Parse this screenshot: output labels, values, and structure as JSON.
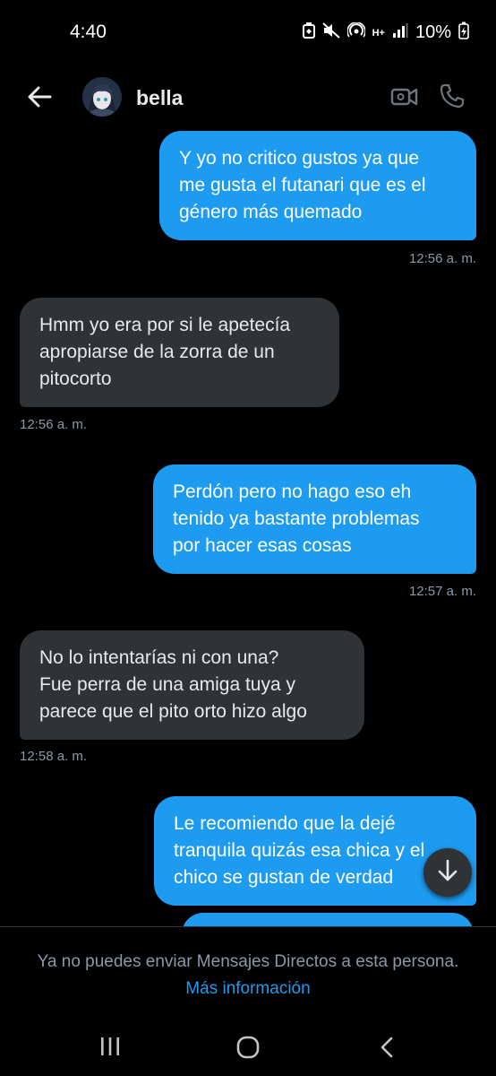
{
  "status_bar": {
    "time": "4:40",
    "battery": "10%",
    "network": "H+"
  },
  "header": {
    "contact_name": "bella",
    "back_icon": "arrow-left-icon",
    "video_icon": "video-camera-icon",
    "call_icon": "phone-icon"
  },
  "messages": [
    {
      "direction": "outgoing",
      "lines": [
        "Y yo no critico gustos ya que",
        "me gusta el futanari que es el",
        "género más quemado"
      ],
      "time": "12:56 a. m."
    },
    {
      "direction": "incoming",
      "lines": [
        "Hmm yo era por si le apetecía",
        "apropiarse de la zorra de un",
        "pitocorto"
      ],
      "time": "12:56 a. m."
    },
    {
      "direction": "outgoing",
      "lines": [
        "Perdón pero no hago eso eh",
        "tenido ya bastante problemas",
        "por hacer esas cosas"
      ],
      "time": "12:57 a. m."
    },
    {
      "direction": "incoming",
      "lines": [
        "No lo intentarías ni con una?",
        "Fue perra de una amiga tuya y",
        "parece que el pito orto hizo algo"
      ],
      "time": "12:58 a. m."
    },
    {
      "direction": "outgoing",
      "lines": [
        "Le recomiendo que la dejé",
        "tranquila quizás esa chica y el",
        "chico se gustan de verdad"
      ],
      "time": ""
    }
  ],
  "footer": {
    "notice": "Ya no puedes enviar Mensajes Directos a esta persona.",
    "link": "Más información"
  },
  "colors": {
    "background": "#000000",
    "outgoing_bubble": "#1d9bf0",
    "incoming_bubble": "#2f3336",
    "timestamp": "#8b98a5",
    "link": "#1d9bf0"
  }
}
